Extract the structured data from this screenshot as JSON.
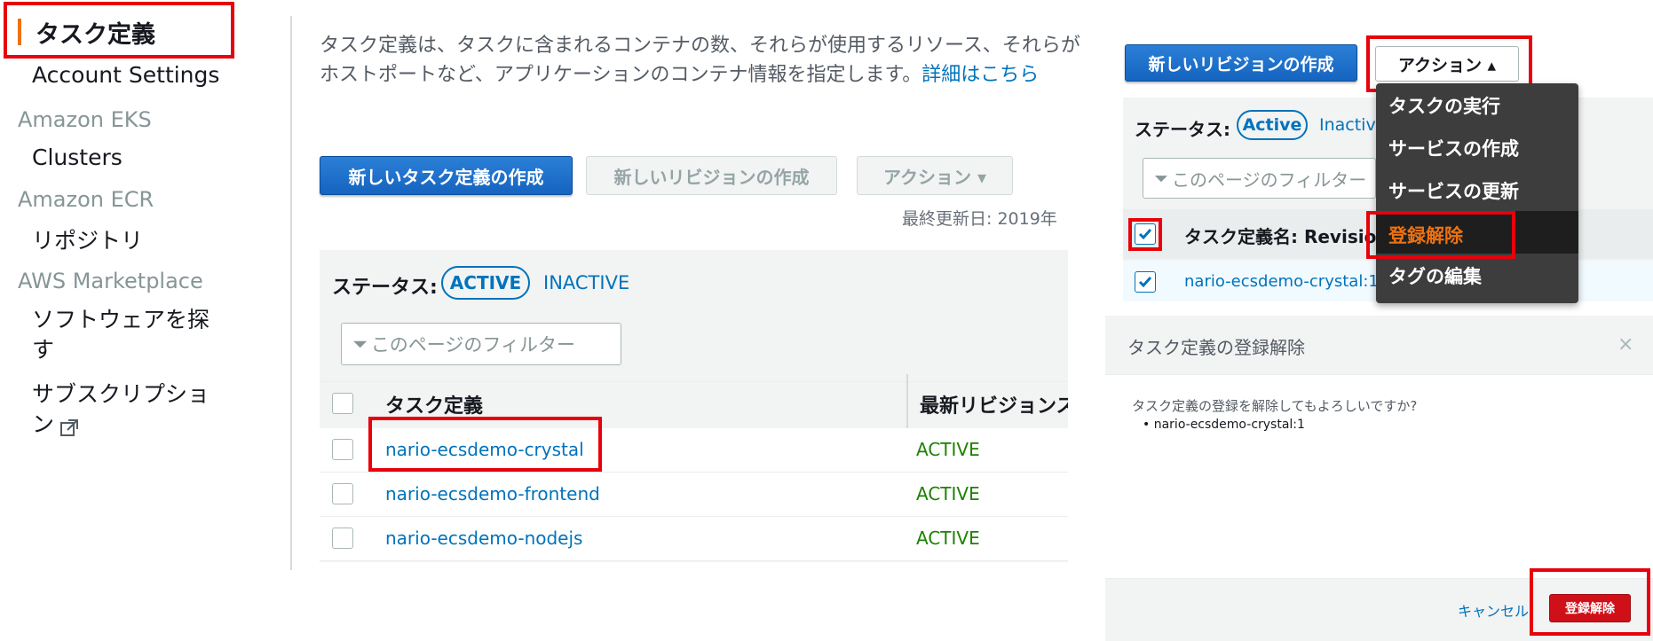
{
  "sidebar": {
    "active_item": "タスク定義",
    "items": [
      {
        "label": "Account Settings"
      },
      {
        "section": "Amazon EKS"
      },
      {
        "label": "Clusters"
      },
      {
        "section": "Amazon ECR"
      },
      {
        "label": "リポジトリ"
      },
      {
        "section": "AWS Marketplace"
      },
      {
        "label_line1": "ソフトウェアを探",
        "label_line2": "す"
      },
      {
        "label_line1": "サブスクリプショ",
        "label_line2": "ン"
      }
    ]
  },
  "main": {
    "description_line1": "タスク定義は、タスクに含まれるコンテナの数、それらが使用するリソース、それらが",
    "description_line2": "ホストポートなど、アプリケーションのコンテナ情報を指定します。",
    "description_link": "詳細はこちら",
    "create_button": "新しいタスク定義の作成",
    "revision_button": "新しいリビジョンの作成",
    "actions_button": "アクション ▾",
    "last_updated": "最終更新日: 2019年",
    "status_label": "ステータス:",
    "status_active": "ACTIVE",
    "status_inactive": "INACTIVE",
    "filter_placeholder": "このページのフィルター",
    "columns": [
      "タスク定義",
      "最新リビジョンス"
    ],
    "rows": [
      {
        "name": "nario-ecsdemo-crystal",
        "status": "ACTIVE"
      },
      {
        "name": "nario-ecsdemo-frontend",
        "status": "ACTIVE"
      },
      {
        "name": "nario-ecsdemo-nodejs",
        "status": "ACTIVE"
      }
    ]
  },
  "right": {
    "revision_button": "新しいリビジョンの作成",
    "actions_button": "アクション ▴",
    "status_label": "ステータス:",
    "status_active": "Active",
    "status_inactive": "Inactive",
    "filter_placeholder": "このページのフィルター",
    "column": "タスク定義名: Revision",
    "row": "nario-ecsdemo-crystal:1",
    "dropdown": [
      "タスクの実行",
      "サービスの作成",
      "サービスの更新",
      "登録解除",
      "タグの編集"
    ],
    "modal": {
      "title": "タスク定義の登録解除",
      "close": "×",
      "question": "タスク定義の登録を解除してもよろしいですか?",
      "item": "nario-ecsdemo-crystal:1",
      "cancel": "キャンセル",
      "confirm": "登録解除"
    }
  },
  "colors": {
    "link": "#0073bb",
    "primary": "#1564c0",
    "active_green": "#1d8102",
    "highlight": "#e8000b",
    "danger_text": "#ec7211"
  }
}
